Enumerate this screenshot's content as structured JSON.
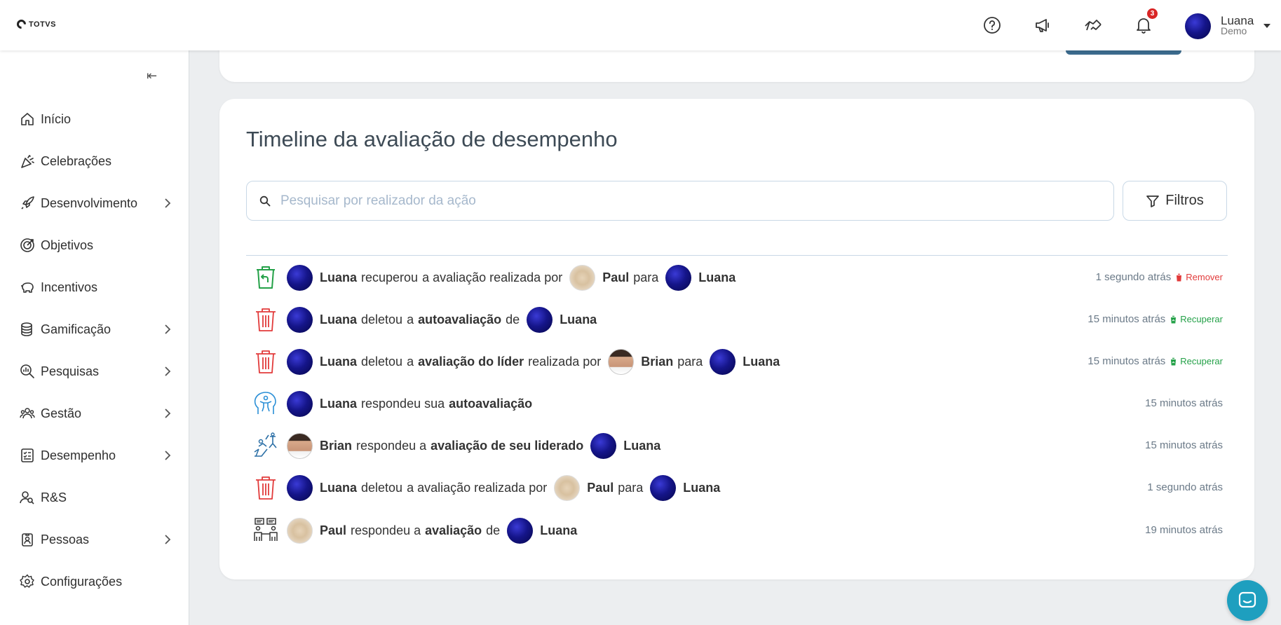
{
  "header": {
    "logo_text": "TOTVS",
    "notification_count": "3",
    "user": {
      "name": "Luana",
      "subtitle": "Demo"
    }
  },
  "sidebar": {
    "items": [
      {
        "label": "Início",
        "icon": "home-icon",
        "chevron": false
      },
      {
        "label": "Celebrações",
        "icon": "party-icon",
        "chevron": false
      },
      {
        "label": "Desenvolvimento",
        "icon": "rocket-icon",
        "chevron": true
      },
      {
        "label": "Objetivos",
        "icon": "target-icon",
        "chevron": false
      },
      {
        "label": "Incentivos",
        "icon": "piggy-bank-icon",
        "chevron": false
      },
      {
        "label": "Gamificação",
        "icon": "coins-icon",
        "chevron": true
      },
      {
        "label": "Pesquisas",
        "icon": "search-chart-icon",
        "chevron": true
      },
      {
        "label": "Gestão",
        "icon": "team-icon",
        "chevron": true
      },
      {
        "label": "Desempenho",
        "icon": "checklist-icon",
        "chevron": true
      },
      {
        "label": "R&S",
        "icon": "user-search-icon",
        "chevron": false
      },
      {
        "label": "Pessoas",
        "icon": "badge-icon",
        "chevron": true
      },
      {
        "label": "Configurações",
        "icon": "gear-icon",
        "chevron": false
      }
    ]
  },
  "timeline": {
    "title": "Timeline da avaliação de desempenho",
    "search_placeholder": "Pesquisar por realizador da ação",
    "filter_label": "Filtros",
    "remove_label": "Remover",
    "recover_label": "Recuperar",
    "rows": [
      {
        "actor": "Luana",
        "verb": "recuperou",
        "obj_pre": "a avaliação realizada por",
        "obj_bold": "",
        "mid": "Paul",
        "join": "para",
        "target": "Luana",
        "time": "1 segundo atrás"
      },
      {
        "actor": "Luana",
        "verb": "deletou",
        "obj_pre": "a",
        "obj_bold": "autoavaliação",
        "join": "de",
        "target": "Luana",
        "time": "15 minutos atrás"
      },
      {
        "actor": "Luana",
        "verb": "deletou",
        "obj_pre": "a",
        "obj_bold": "avaliação do líder",
        "obj_post": "realizada por",
        "mid": "Brian",
        "join": "para",
        "target": "Luana",
        "time": "15 minutos atrás"
      },
      {
        "actor": "Luana",
        "verb": "respondeu sua",
        "obj_bold": "autoavaliação",
        "time": "15 minutos atrás"
      },
      {
        "actor": "Brian",
        "verb": "respondeu a",
        "obj_bold": "avaliação de seu liderado",
        "target": "Luana",
        "time": "15 minutos atrás"
      },
      {
        "actor": "Luana",
        "verb": "deletou",
        "obj_pre": "a avaliação realizada por",
        "mid": "Paul",
        "join": "para",
        "target": "Luana",
        "time": "1 segundo atrás"
      },
      {
        "actor": "Paul",
        "verb": "respondeu a",
        "obj_bold": "avaliação",
        "join": "de",
        "target": "Luana",
        "time": "19 minutos atrás"
      }
    ]
  }
}
